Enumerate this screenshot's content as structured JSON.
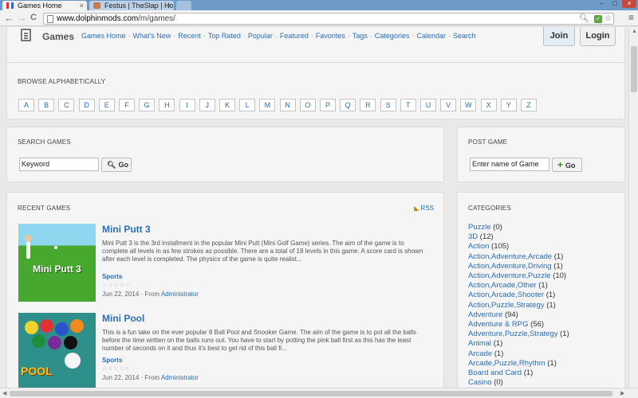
{
  "browser": {
    "tabs": [
      {
        "title": "Games Home",
        "close": "×"
      },
      {
        "title": "Festus | TheSlap | Ho",
        "close": "×"
      }
    ],
    "url_prefix": "www.dolphinmods.com",
    "url_path": "/m/games/",
    "nav_back": "←",
    "nav_forward": "→",
    "nav_reload": "C",
    "menu": "≡",
    "win_min": "–",
    "win_max": "□",
    "win_close": "×"
  },
  "header": {
    "brand": "Games",
    "nav": [
      "Games Home",
      "What's New",
      "Recent",
      "Top Rated",
      "Popular",
      "Featured",
      "Favorites",
      "Tags",
      "Categories",
      "Calendar",
      "Search"
    ],
    "join": "Join",
    "login": "Login"
  },
  "browse": {
    "title": "BROWSE ALPHABETICALLY",
    "letters": [
      "A",
      "B",
      "C",
      "D",
      "E",
      "F",
      "G",
      "H",
      "I",
      "J",
      "K",
      "L",
      "M",
      "N",
      "O",
      "P",
      "Q",
      "R",
      "S",
      "T",
      "U",
      "V",
      "W",
      "X",
      "Y",
      "Z"
    ]
  },
  "search": {
    "title": "SEARCH GAMES",
    "value": "Keyword",
    "go": "Go"
  },
  "post": {
    "title": "POST GAME",
    "value": "Enter name of Game",
    "go": "Go"
  },
  "recent": {
    "title": "RECENT GAMES",
    "rss": "RSS",
    "games": [
      {
        "title": "Mini Putt 3",
        "thumb_label": "Mini Putt 3",
        "desc": "Mini Putt 3 is the 3rd installment in the popular Mini Putt (Mini Golf Game) series. The aim of the game is to complete all levels in as few strokes as possible. There are a total of 18 levels in this game. A score card is shown after each level is completed. The physics of the game is quite realist...",
        "category": "Sports",
        "stars": "☆☆☆☆☆",
        "date": "Jun 22, 2014",
        "from": "· From",
        "author": "Administrator"
      },
      {
        "title": "Mini Pool",
        "thumb_label": "POOL",
        "desc": "This is a fun take on the ever popular 8 Ball Pool and Snooker Game. The aim of the game is to pot all the balls before the time written on the balls runs out. You have to start by potting the pink ball first as this has the least number of seconds on it and thus it's best to get rid of this ball fi...",
        "category": "Sports",
        "stars": "☆☆☆☆☆",
        "date": "Jun 22, 2014",
        "from": "· From",
        "author": "Administrator"
      }
    ]
  },
  "categories": {
    "title": "CATEGORIES",
    "items": [
      {
        "name": "Puzzle",
        "count": "(0)"
      },
      {
        "name": "3D",
        "count": "(12)"
      },
      {
        "name": "Action",
        "count": "(105)"
      },
      {
        "name": "Action,Adventure,Arcade",
        "count": "(1)"
      },
      {
        "name": "Action,Adventure,Driving",
        "count": "(1)"
      },
      {
        "name": "Action,Adventure,Puzzle",
        "count": "(10)"
      },
      {
        "name": "Action,Arcade,Other",
        "count": "(1)"
      },
      {
        "name": "Action,Arcade,Shooter",
        "count": "(1)"
      },
      {
        "name": "Action,Puzzle,Strategy",
        "count": "(1)"
      },
      {
        "name": "Adventure",
        "count": "(94)"
      },
      {
        "name": "Adventure & RPG",
        "count": "(56)"
      },
      {
        "name": "Adventure,Puzzle,Strategy",
        "count": "(1)"
      },
      {
        "name": "Animal",
        "count": "(1)"
      },
      {
        "name": "Arcade",
        "count": "(1)"
      },
      {
        "name": "Arcade,Puzzle,Rhythm",
        "count": "(1)"
      },
      {
        "name": "Board and Card",
        "count": "(1)"
      },
      {
        "name": "Casino",
        "count": "(0)"
      }
    ]
  },
  "colors": {
    "link": "#2a6ebb",
    "accent_green": "#3a8a2a",
    "tab_bar": "#6e9ac8"
  }
}
